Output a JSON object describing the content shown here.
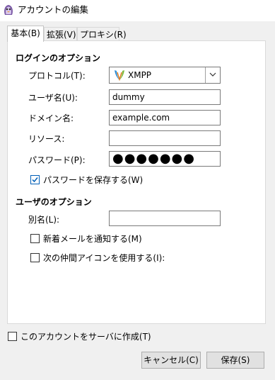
{
  "window": {
    "title": "アカウントの編集"
  },
  "tabs": [
    {
      "label": "基本(B)"
    },
    {
      "label": "拡張(V)"
    },
    {
      "label": "プロキシ(R)"
    }
  ],
  "login_options": {
    "heading": "ログインのオプション",
    "protocol": {
      "label": "プロトコル(T):",
      "value": "XMPP"
    },
    "username": {
      "label": "ユーザ名(U):",
      "value": "dummy"
    },
    "domain": {
      "label": "ドメイン名:",
      "value": "example.com"
    },
    "resource": {
      "label": "リソース:",
      "value": ""
    },
    "password": {
      "label": "パスワード(P):",
      "value": "●●●●●●●"
    },
    "save_password": {
      "label": "パスワードを保存する(W)",
      "checked": true
    }
  },
  "user_options": {
    "heading": "ユーザのオプション",
    "alias": {
      "label": "別名(L):",
      "value": ""
    },
    "notify_new_mail": {
      "label": "新着メールを通知する(M)",
      "checked": false
    },
    "use_buddy_icon": {
      "label": "次の仲間アイコンを使用する(I):",
      "checked": false
    }
  },
  "create_on_server": {
    "label": "このアカウントをサーバに作成(T)",
    "checked": false
  },
  "buttons": {
    "cancel": "キャンセル(C)",
    "save": "保存(S)"
  },
  "colors": {
    "check_accent": "#005fb8",
    "dialog_bg": "#f0f0f0"
  }
}
